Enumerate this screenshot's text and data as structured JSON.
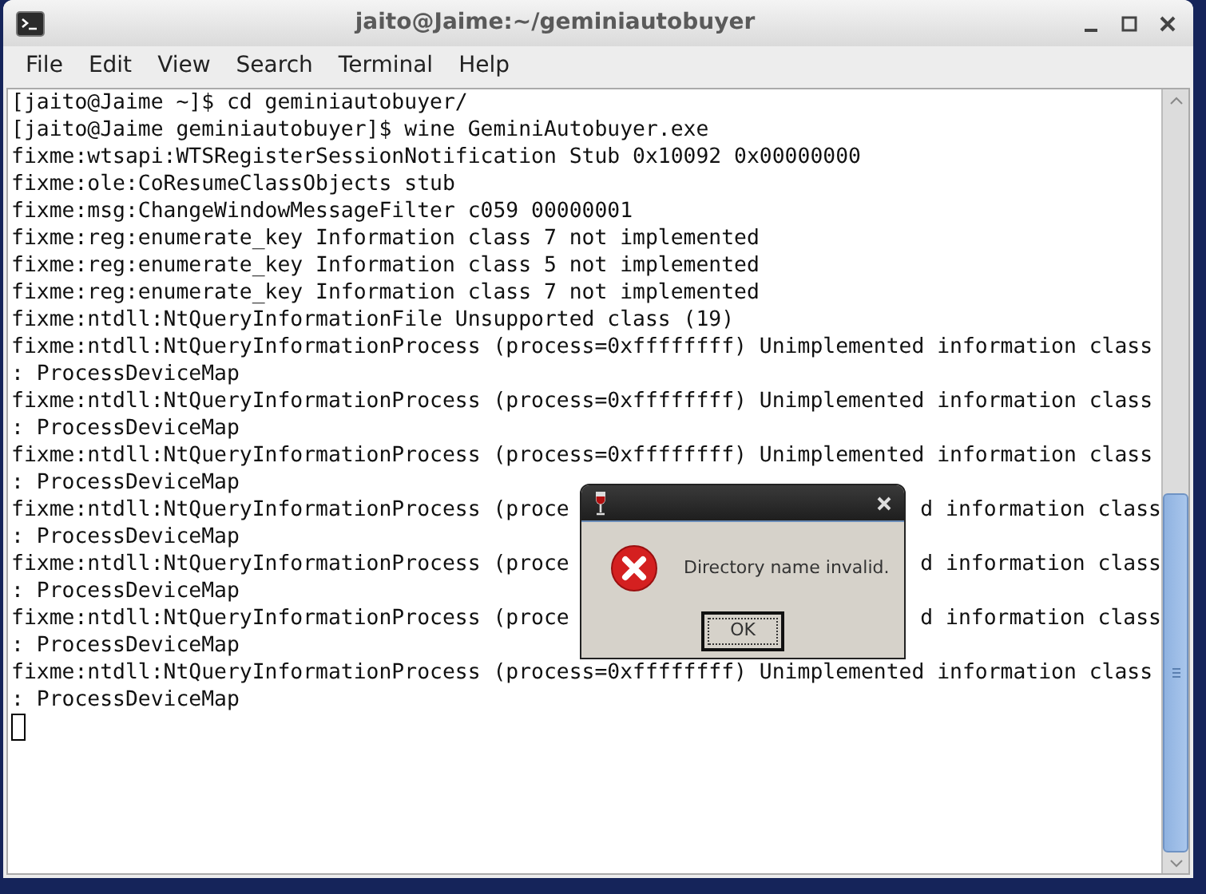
{
  "window": {
    "title": "jaito@Jaime:~/geminiautobuyer"
  },
  "menu": [
    "File",
    "Edit",
    "View",
    "Search",
    "Terminal",
    "Help"
  ],
  "terminal": {
    "lines": [
      {
        "text": "[jaito@Jaime ~]$ cd geminiautobuyer/"
      },
      {
        "text": "[jaito@Jaime geminiautobuyer]$ wine GeminiAutobuyer.exe"
      },
      {
        "text": "fixme:wtsapi:WTSRegisterSessionNotification Stub 0x10092 0x00000000"
      },
      {
        "text": "fixme:ole:CoResumeClassObjects stub"
      },
      {
        "text": "fixme:msg:ChangeWindowMessageFilter c059 00000001"
      },
      {
        "text": "fixme:reg:enumerate_key Information class 7 not implemented"
      },
      {
        "text": "fixme:reg:enumerate_key Information class 5 not implemented"
      },
      {
        "text": "fixme:reg:enumerate_key Information class 7 not implemented"
      },
      {
        "text": "fixme:ntdll:NtQueryInformationFile Unsupported class (19)"
      },
      {
        "text": "fixme:ntdll:NtQueryInformationProcess (process=0xffffffff) Unimplemented information class"
      },
      {
        "text": ": ProcessDeviceMap"
      },
      {
        "text": "fixme:ntdll:NtQueryInformationProcess (process=0xffffffff) Unimplemented information class"
      },
      {
        "text": ": ProcessDeviceMap"
      },
      {
        "text": "fixme:ntdll:NtQueryInformationProcess (process=0xffffffff) Unimplemented information class"
      },
      {
        "text": ": ProcessDeviceMap"
      },
      {
        "text": "fixme:ntdll:NtQueryInformationProcess (proce",
        "tail": "d information class"
      },
      {
        "text": ": ProcessDeviceMap"
      },
      {
        "text": "fixme:ntdll:NtQueryInformationProcess (proce",
        "tail": "d information class"
      },
      {
        "text": ": ProcessDeviceMap"
      },
      {
        "text": "fixme:ntdll:NtQueryInformationProcess (proce",
        "tail": "d information class"
      },
      {
        "text": ": ProcessDeviceMap"
      },
      {
        "text": "fixme:ntdll:NtQueryInformationProcess (process=0xffffffff) Unimplemented information class"
      },
      {
        "text": ": ProcessDeviceMap"
      }
    ]
  },
  "dialog": {
    "message": "Directory name invalid.",
    "button": "OK"
  }
}
